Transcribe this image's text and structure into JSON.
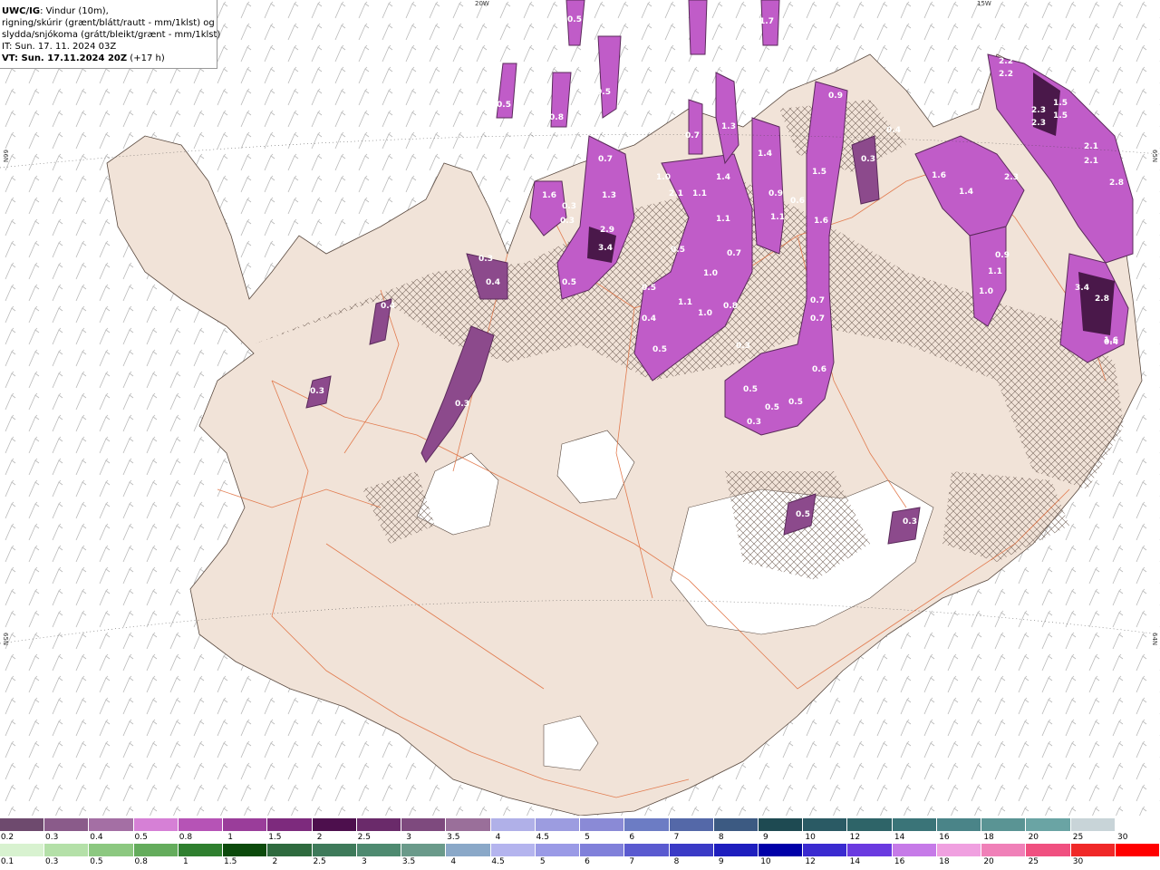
{
  "title": {
    "product": "UWC/IG",
    "line1_rest": ": Vindur (10m),",
    "line2": "rigning/skúrir (grænt/blátt/rautt - mm/1klst) og",
    "line3": "slydda/snjókoma (grátt/bleikt/grænt - mm/1klst)",
    "line4": "IT: Sun. 17. 11. 2024 03Z",
    "line5_bold": "VT: Sun. 17.11.2024 20Z",
    "line5_rest": " (+17 h)"
  },
  "graticule": {
    "top_left": "20W",
    "top_right": "15W",
    "left_upper": "66N",
    "left_lower": "65N",
    "right_upper": "65N",
    "right_lower": "64N"
  },
  "precip_labels": [
    "0.5",
    "1.7",
    "1.2",
    "0.5",
    "0.5",
    "0.8",
    "0.7",
    "1.3",
    "0.9",
    "2.1",
    "2.2",
    "2.2",
    "2.3",
    "2.3",
    "1.5",
    "1.5",
    "0.4",
    "0.3",
    "0.7",
    "1.3",
    "1.4",
    "1.5",
    "1.6",
    "1.0",
    "2.1",
    "1.1",
    "1.4",
    "0.9",
    "0.6",
    "1.1",
    "1.6",
    "2.1",
    "2.1",
    "2.8",
    "2.3",
    "1.6",
    "1.4",
    "0.3",
    "0.3",
    "2.9",
    "3.4",
    "1.1",
    "0.5",
    "1.0",
    "0.7",
    "0.3",
    "0.4",
    "0.5",
    "0.4",
    "0.9",
    "1.1",
    "1.0",
    "3.4",
    "2.8",
    "1.1",
    "1.0",
    "0.8",
    "0.3",
    "0.7",
    "0.7",
    "0.4",
    "0.5",
    "0.5",
    "0.6",
    "0.3",
    "0.3",
    "0.5",
    "0.5",
    "0.5",
    "0.3",
    "0.5",
    "0.3",
    "1.6",
    "0.4"
  ],
  "legend_snow": {
    "colors": [
      "#6e4a6e",
      "#8a5b8a",
      "#a46fa4",
      "#d680d6",
      "#b653b6",
      "#9a3d9a",
      "#7d2a7d",
      "#4d0f4d",
      "#6a2a6a",
      "#7e4a7e",
      "#9a6f9a",
      "#b0b0e8",
      "#9c9ce0",
      "#8a8ad6",
      "#6c7cc4",
      "#5468a8",
      "#3c5a82",
      "#1e4a52",
      "#2a5a64",
      "#2e6468",
      "#3a7478",
      "#4a8488",
      "#5a9494",
      "#6aa4a4",
      "#c8d4d8",
      "#ffffff"
    ],
    "labels": [
      "0.2",
      "0.3",
      "0.4",
      "0.5",
      "0.8",
      "1",
      "1.5",
      "2",
      "2.5",
      "3",
      "3.5",
      "4",
      "4.5",
      "5",
      "6",
      "7",
      "8",
      "9",
      "10",
      "12",
      "14",
      "16",
      "18",
      "20",
      "25",
      "30"
    ]
  },
  "legend_rain": {
    "colors": [
      "#d8f2d0",
      "#b4e0a8",
      "#8cc880",
      "#64ac5c",
      "#2f7f2f",
      "#0c4a0c",
      "#2e6a3e",
      "#3e7a5a",
      "#4e8a70",
      "#6a9a8a",
      "#8aa8c8",
      "#b4b4ee",
      "#9a9ae6",
      "#8080da",
      "#5a5ad0",
      "#3a3ac6",
      "#1e1ebe",
      "#0000a8",
      "#3a2ad0",
      "#6a3ae0",
      "#c67ae8",
      "#f0a0e0",
      "#f080b8",
      "#f05080",
      "#f02828",
      "#ff0000"
    ],
    "labels": [
      "0.1",
      "0.3",
      "0.5",
      "0.8",
      "1",
      "1.5",
      "2",
      "2.5",
      "3",
      "3.5",
      "4",
      "4.5",
      "5",
      "6",
      "7",
      "8",
      "9",
      "10",
      "12",
      "14",
      "16",
      "18",
      "20",
      "25",
      "30"
    ]
  }
}
